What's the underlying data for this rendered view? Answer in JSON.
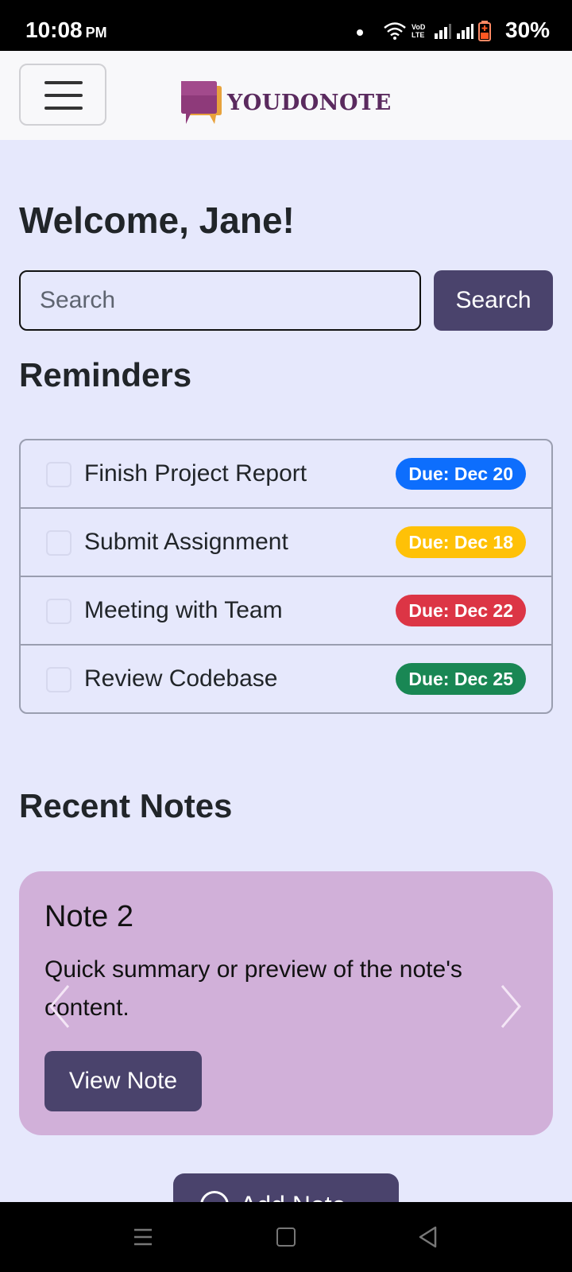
{
  "status_bar": {
    "time": "10:08",
    "ampm": "PM",
    "network_label": "VoD LTE",
    "battery": "30%"
  },
  "header": {
    "menu_icon": "hamburger-icon",
    "brand": "YOUDONOTE"
  },
  "greeting": "Welcome, Jane!",
  "search": {
    "placeholder": "Search",
    "button_label": "Search"
  },
  "reminders": {
    "title": "Reminders",
    "items": [
      {
        "label": "Finish Project Report",
        "due": "Due: Dec 20",
        "color": "#0d6efd"
      },
      {
        "label": "Submit Assignment",
        "due": "Due: Dec 18",
        "color": "#ffc107"
      },
      {
        "label": "Meeting with Team",
        "due": "Due: Dec 22",
        "color": "#dc3545"
      },
      {
        "label": "Review Codebase",
        "due": "Due: Dec 25",
        "color": "#198754"
      }
    ]
  },
  "recent_notes": {
    "title": "Recent Notes",
    "note": {
      "title": "Note 2",
      "body": "Quick summary or preview of the note's content.",
      "button_label": "View Note"
    }
  },
  "add_note_label": "Add Note",
  "colors": {
    "background": "#e6e8fc",
    "primary_button": "#4a436c",
    "note_card": "#d1b0d9",
    "brand_text": "#5a2a5e"
  }
}
